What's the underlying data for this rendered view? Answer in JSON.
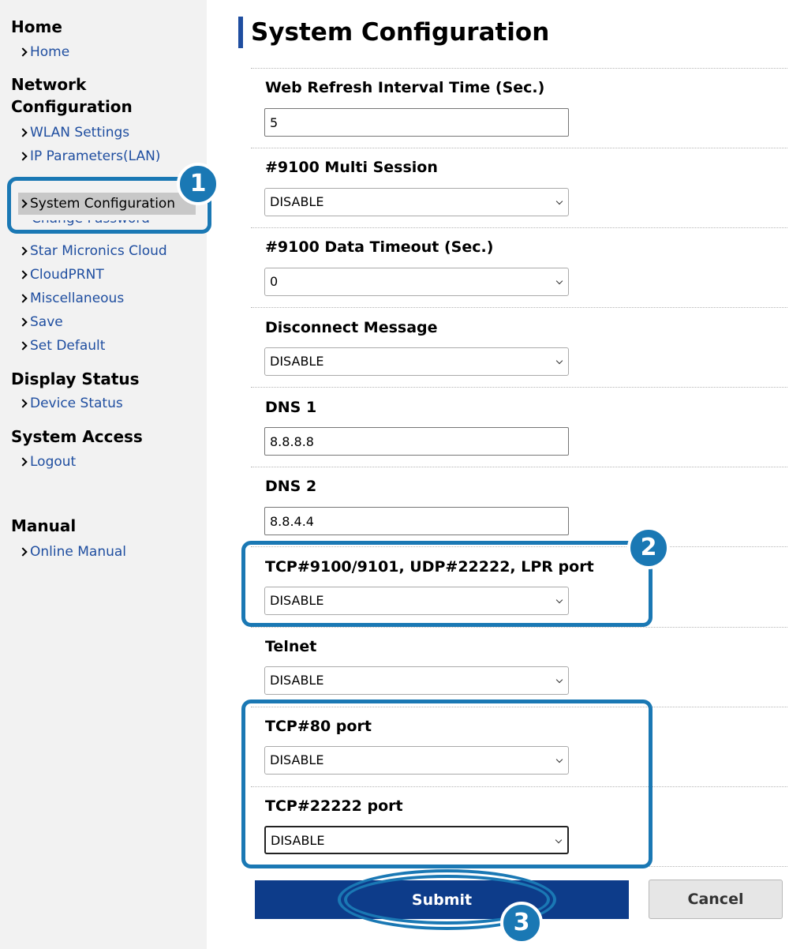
{
  "sidebar": {
    "sections": {
      "home": "Home",
      "network": "Network Configuration",
      "display": "Display Status",
      "access": "System Access",
      "manual": "Manual"
    },
    "links": {
      "home": "Home",
      "wlan": "WLAN Settings",
      "ip": "IP Parameters(LAN)",
      "system": "System Configuration",
      "change_password": "Change Password",
      "cloud": "Star Micronics Cloud",
      "cloudprnt": "CloudPRNT",
      "misc": "Miscellaneous",
      "save": "Save",
      "set_default": "Set Default",
      "device_status": "Device Status",
      "logout": "Logout",
      "online_manual": "Online Manual"
    }
  },
  "main": {
    "title": "System Configuration",
    "fields": {
      "refresh": {
        "label": "Web Refresh Interval Time (Sec.)",
        "value": "5"
      },
      "multi_session": {
        "label": "#9100 Multi Session",
        "value": "DISABLE"
      },
      "data_timeout": {
        "label": "#9100 Data Timeout (Sec.)",
        "value": "0"
      },
      "disconnect": {
        "label": "Disconnect Message",
        "value": "DISABLE"
      },
      "dns1": {
        "label": "DNS 1",
        "value": "8.8.8.8"
      },
      "dns2": {
        "label": "DNS 2",
        "value": "8.8.4.4"
      },
      "tcp9100": {
        "label": "TCP#9100/9101, UDP#22222, LPR port",
        "value": "DISABLE"
      },
      "telnet": {
        "label": "Telnet",
        "value": "DISABLE"
      },
      "tcp80": {
        "label": "TCP#80 port",
        "value": "DISABLE"
      },
      "tcp22222": {
        "label": "TCP#22222 port",
        "value": "DISABLE"
      }
    },
    "buttons": {
      "submit": "Submit",
      "cancel": "Cancel"
    }
  },
  "annotations": {
    "step1": "1",
    "step2": "2",
    "step3": "3",
    "color": "#1a78b4"
  },
  "colors": {
    "link": "#1f4ea0",
    "primary_button": "#0d3c8a",
    "sidebar_bg": "#f2f2f2",
    "active_item": "#c8c8c8"
  },
  "icons": {
    "nav_bullet": "chevron-right-icon",
    "select_caret": "chevron-down-icon"
  }
}
